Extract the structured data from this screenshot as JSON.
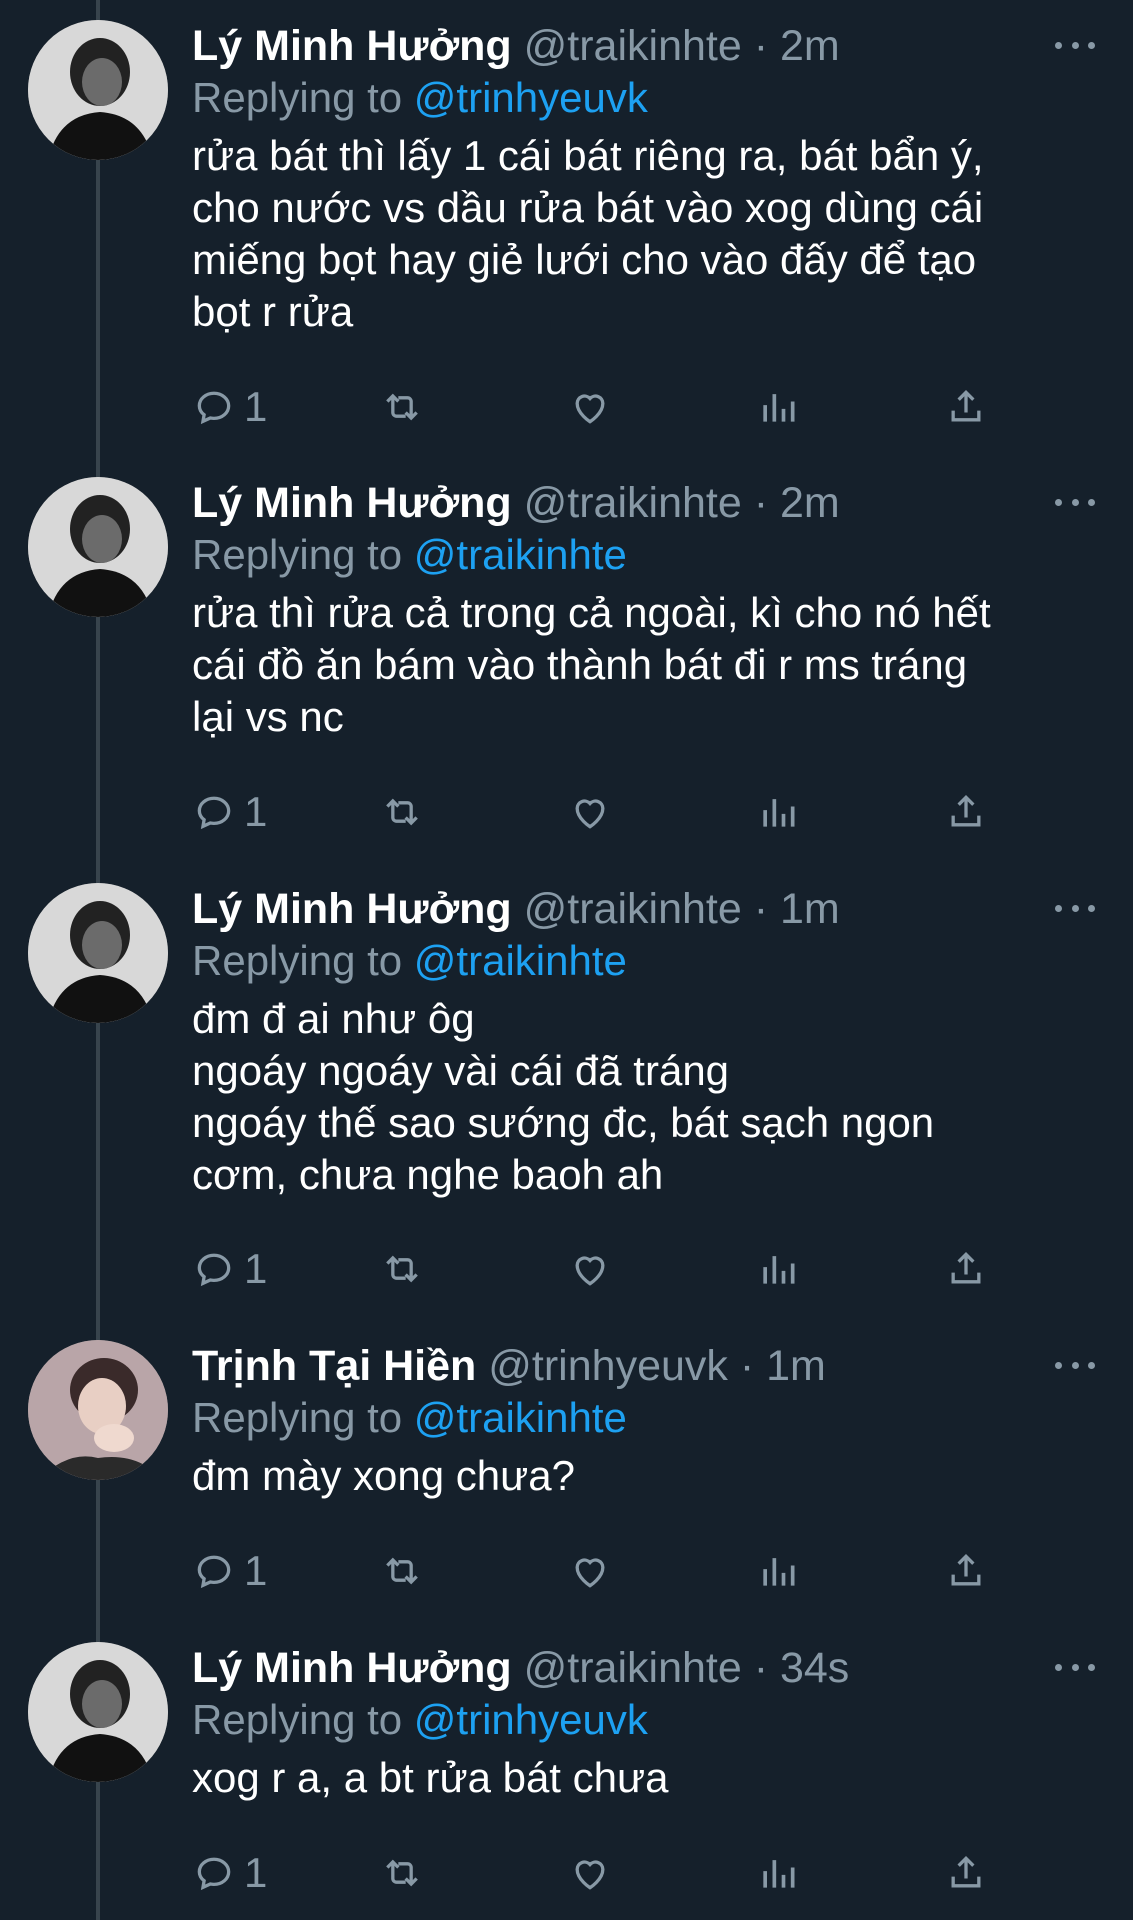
{
  "colors": {
    "background": "#15202b",
    "muted": "#8899a6",
    "mention": "#1da1f2",
    "thread_line": "#38444d"
  },
  "tweets": [
    {
      "name": "Lý Minh Hưởng",
      "meta": "@traikinhte · 2m",
      "reply_prefix": "Replying to ",
      "reply_to": "@trinhyeuvk",
      "text": "rửa bát thì lấy 1 cái bát riêng ra, bát bẩn ý,\ncho nước vs dầu rửa bát vào xog dùng cái\nmiếng bọt hay giẻ lưới cho vào đấy để tạo\nbọt r rửa",
      "reply_count": "1",
      "avatar": "avatar-minh"
    },
    {
      "name": "Lý Minh Hưởng",
      "meta": "@traikinhte · 2m",
      "reply_prefix": "Replying to ",
      "reply_to": "@traikinhte",
      "text": "rửa thì rửa cả trong cả ngoài, kì cho nó hết\ncái đồ ăn bám vào thành bát đi r ms tráng\nlại vs nc",
      "reply_count": "1",
      "avatar": "avatar-minh"
    },
    {
      "name": "Lý Minh Hưởng",
      "meta": "@traikinhte · 1m",
      "reply_prefix": "Replying to ",
      "reply_to": "@traikinhte",
      "text": "đm đ ai như ôg\nngoáy ngoáy vài cái đã tráng\nngoáy thế sao sướng đc, bát sạch ngon\ncơm, chưa nghe baoh ah",
      "reply_count": "1",
      "avatar": "avatar-minh"
    },
    {
      "name": "Trịnh Tại Hiền",
      "meta": "@trinhyeuvk · 1m",
      "reply_prefix": "Replying to ",
      "reply_to": "@traikinhte",
      "text": "đm mày xong chưa?",
      "reply_count": "1",
      "avatar": "avatar-hien"
    },
    {
      "name": "Lý Minh Hưởng",
      "meta": "@traikinhte · 34s",
      "reply_prefix": "Replying to ",
      "reply_to": "@trinhyeuvk",
      "text": "xog r a, a bt rửa bát chưa",
      "reply_count": "1",
      "avatar": "avatar-minh"
    }
  ]
}
